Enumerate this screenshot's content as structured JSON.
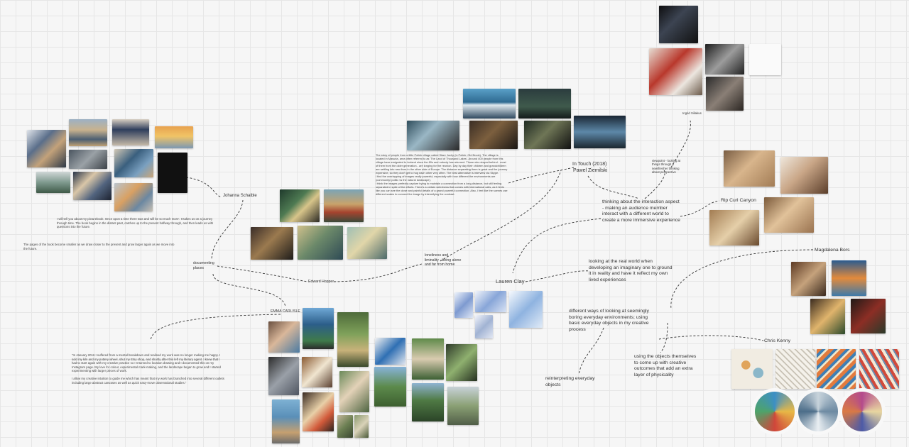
{
  "names": {
    "johanna": "Johanna Schaible",
    "hopper": "Edward Hopper",
    "carlisle": "EMMA CARLISLE",
    "ziemilski_1": "In Touch (2018)",
    "ziemilski_2": "Pawel Ziemilski",
    "clay": "Lauren Clay",
    "rip": "Rip Curl Canyon",
    "bors": "Magdalena Bors",
    "kenny": "Chris Kenny",
    "ingrid": "Ingrid Siliakus"
  },
  "labels": {
    "documenting": "documenting places",
    "loneliness": "loneliness and liminality - being alone and far from home",
    "viewpoint": "viewpoint - looking at things through a new/fresher thinking about perspective"
  },
  "notes": {
    "interaction": "thinking about the interaction aspect - making an audience member interact with a different world to create a more immersive experience",
    "real_world": "looking at the real world when developing an imaginary one to ground it in reality and have it reflect my own lived experiences",
    "different_ways": "different ways of looking at seemingly boring everyday environments; using basic everyday objects in my creative process",
    "objects": "using the objects themselves to come up with creative outcomes that add an extra layer of physicality",
    "reinterpreting": "reinterpreting everyday objects"
  },
  "paragraphs": {
    "johanna_1": "I will tell you about my picturebook. Once upon a time there was and will be so much more'. It takes us on a journey through time. The book begins in the distant past, catches up to the present halfway through, and then leads us with questions into the future.",
    "johanna_2": "The pages of the book become smaller as we draw closer to the present and grow larger again as we move into the future.",
    "intouch_1": "The story of people from a little Polish village called Stare Juchy (in Polish: Old Brook). The village is located in Masuria, area often referred to as 'The Land of Thousand Lakes'. Around 400 people from this village have emigrated to Iceland since the 80s and nobody has returned. Those who stayed behind - most of them from the older generation - are longing for the reunion. Day by day their children and grandchildren are settling into new lives in the other side of Europe. The distance separating them is great and the journey expensive, so they don't get to hug each other very often. The best alternative is interview via Skype.",
    "intouch_2": "I find the overlapping of images really powerful, especially with how different the environments are (community/ politic vs the natural landscape).",
    "intouch_3": "I think the images perfectly capture trying to maintain a connection from a long distance, but still feeling separated in spite of the efforts. There's a certain weirdness that comes with international calls, as it feels like you can see the close and painful details of a grand powerful connection. Also, I feel like the scenes use different scales to connect the image by intensifying the contrast.",
    "emma_1": "\"In January 2016 I suffered from a mental breakdown and realised my work was no longer making me happy. I sold my kiln and my pottery wheel, shut my Etsy shop, and shortly after this left my literary agent. I knew that I had to start again with my creative practice so I returned to location drawing and I documented this on my Instagram page. My love for colour, experimental mark-making, and the landscape began to grow and I started experimenting with larger pieces of work.",
    "emma_2": "I allow my creative intuition to guide me which has meant that my work has branched into several different outlets including large abstract canvases as well as quick easy-move observational studies.\""
  },
  "colors": {
    "background": "#f6f6f6",
    "gridline": "#e6e6e6",
    "connector": "#333333"
  }
}
